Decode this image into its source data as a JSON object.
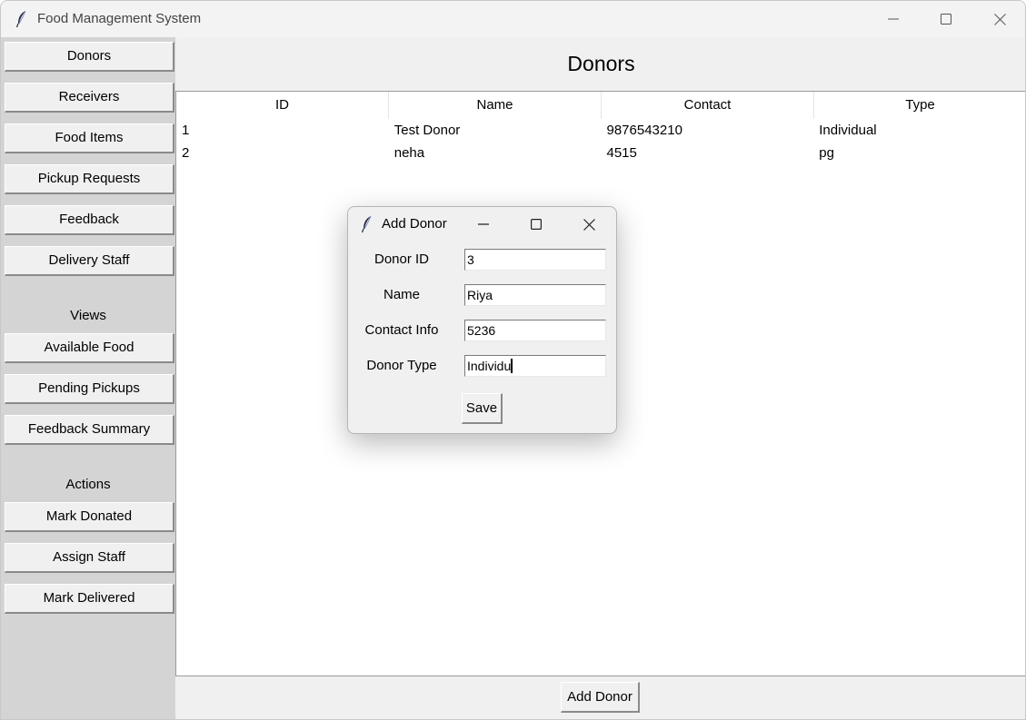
{
  "window": {
    "title": "Food Management System",
    "controls": {
      "minimize_icon": "minimize-icon",
      "maximize_icon": "maximize-icon",
      "close_icon": "close-icon"
    }
  },
  "sidebar": {
    "items": [
      {
        "label": "Donors"
      },
      {
        "label": "Receivers"
      },
      {
        "label": "Food Items"
      },
      {
        "label": "Pickup Requests"
      },
      {
        "label": "Feedback"
      },
      {
        "label": "Delivery Staff"
      }
    ],
    "views_heading": "Views",
    "views": [
      {
        "label": "Available Food"
      },
      {
        "label": "Pending Pickups"
      },
      {
        "label": "Feedback Summary"
      }
    ],
    "actions_heading": "Actions",
    "actions": [
      {
        "label": "Mark Donated"
      },
      {
        "label": "Assign Staff"
      },
      {
        "label": "Mark Delivered"
      }
    ]
  },
  "main": {
    "title": "Donors",
    "table": {
      "columns": [
        "ID",
        "Name",
        "Contact",
        "Type"
      ],
      "rows": [
        [
          "1",
          "Test Donor",
          "9876543210",
          "Individual"
        ],
        [
          "2",
          "neha",
          "4515",
          "pg"
        ]
      ]
    },
    "add_button_label": "Add Donor"
  },
  "dialog": {
    "title": "Add Donor",
    "fields": [
      {
        "label": "Donor ID",
        "value": "3"
      },
      {
        "label": "Name",
        "value": "Riya"
      },
      {
        "label": "Contact Info",
        "value": "5236"
      },
      {
        "label": "Donor Type",
        "value": "Individu"
      }
    ],
    "save_label": "Save"
  },
  "colors": {
    "sidebar_bg": "#d4d4d4",
    "window_bg": "#f0f0f0",
    "table_bg": "#ffffff"
  }
}
